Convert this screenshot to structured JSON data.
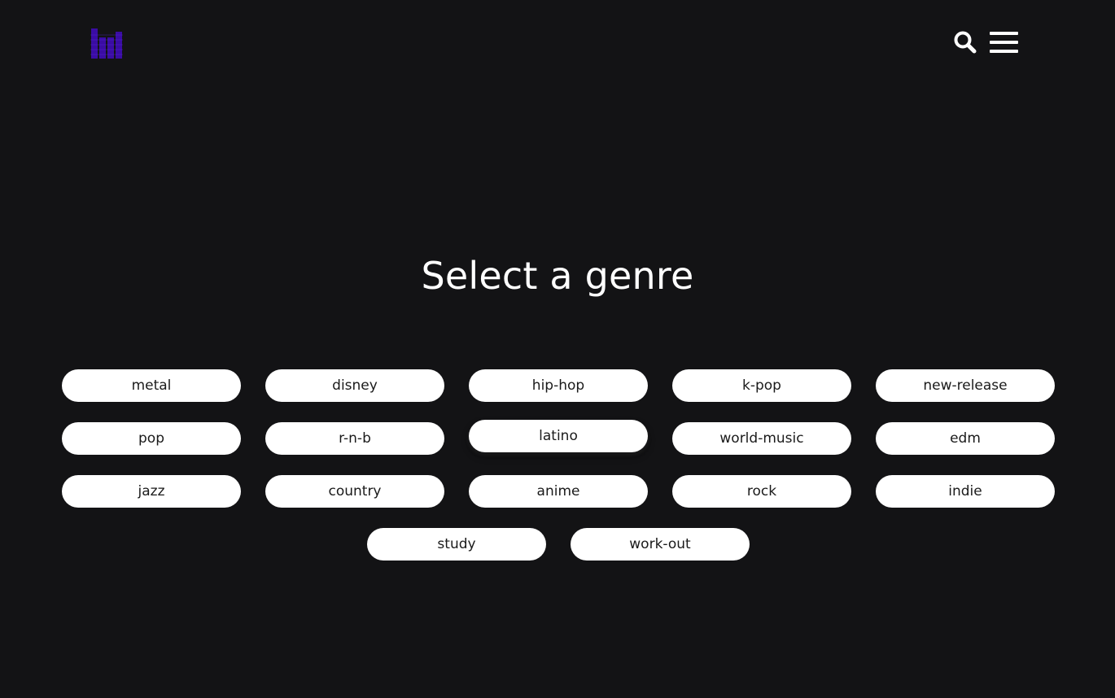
{
  "header": {
    "logo_icon": "equalizer-bars-logo",
    "logo_color": "#3a0ca3",
    "search_icon": "search-icon",
    "menu_icon": "hamburger-menu-icon"
  },
  "main": {
    "title": "Select a genre",
    "genres": [
      [
        "metal",
        "disney",
        "hip-hop",
        "k-pop",
        "new-release"
      ],
      [
        "pop",
        "r-n-b",
        "latino",
        "world-music",
        "edm"
      ],
      [
        "jazz",
        "country",
        "anime",
        "rock",
        "indie"
      ],
      [
        "study",
        "work-out"
      ]
    ],
    "hovered_genre": "latino"
  },
  "colors": {
    "background": "#131315",
    "button": "#ffffff",
    "button_text": "#1a1a1a",
    "title": "#ffffff"
  }
}
